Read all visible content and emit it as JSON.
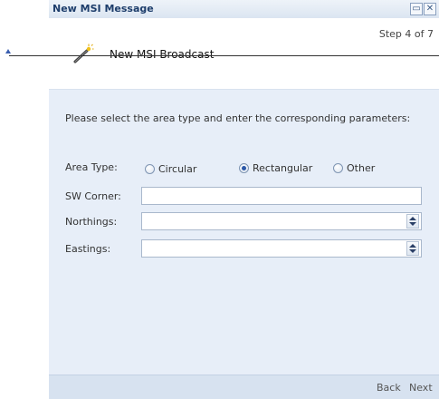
{
  "window": {
    "title": "New MSI Message",
    "restore_icon": "restore-icon",
    "close_icon": "close-icon"
  },
  "header": {
    "step_text": "Step 4 of 7",
    "wizard_icon": "magic-wand-icon",
    "title": "New MSI Broadcast"
  },
  "form": {
    "instruction": "Please select the area type and enter the corresponding parameters:",
    "area_type_label": "Area Type:",
    "options": [
      "Circular",
      "Rectangular",
      "Other"
    ],
    "selected_option": "Rectangular",
    "sw_corner_label": "SW Corner:",
    "sw_corner_value": "",
    "northings_label": "Northings:",
    "northings_value": "",
    "eastings_label": "Eastings:",
    "eastings_value": ""
  },
  "footer": {
    "back_label": "Back",
    "next_label": "Next"
  }
}
